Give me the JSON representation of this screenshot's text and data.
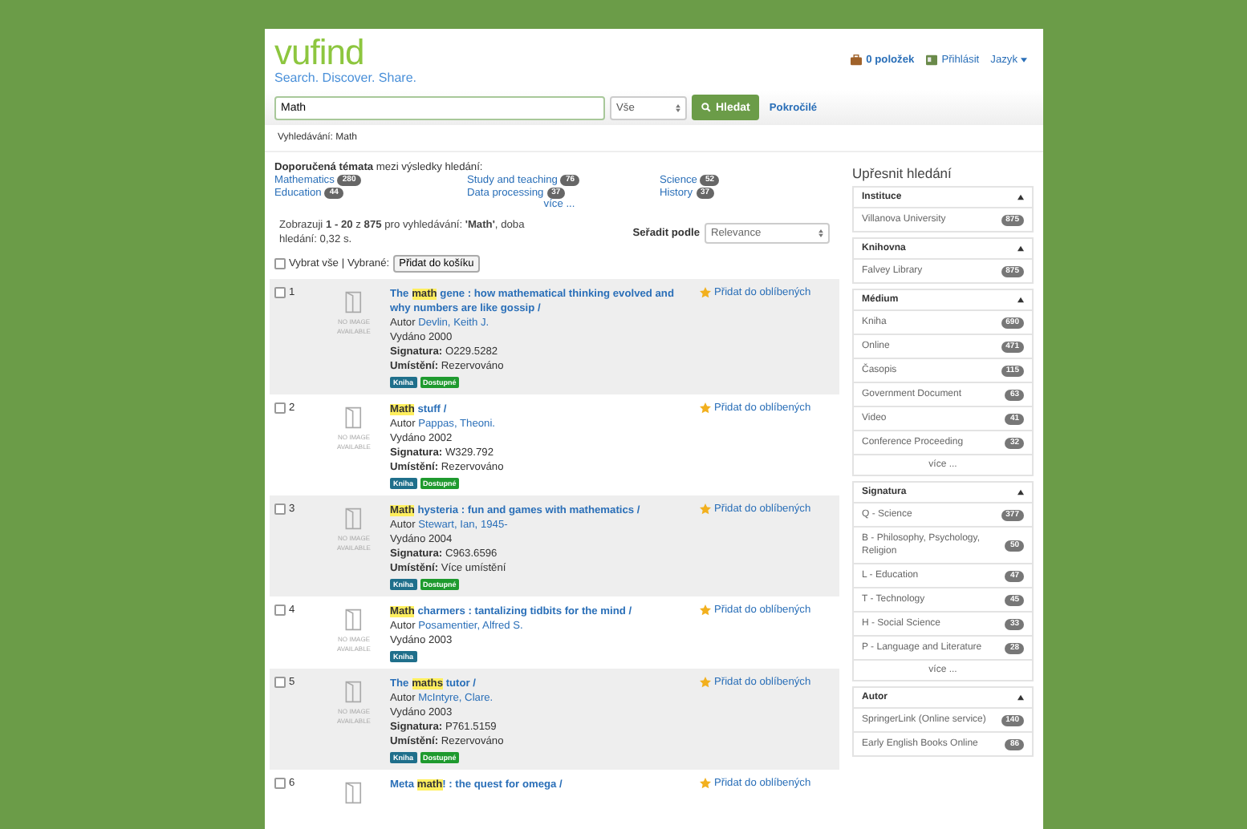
{
  "header": {
    "logo": "vufind",
    "tagline": "Search. Discover. Share.",
    "cart": "0 položek",
    "login": "Přihlásit",
    "language": "Jazyk"
  },
  "search": {
    "value": "Math",
    "scope": "Vše",
    "button": "Hledat",
    "advanced": "Pokročilé"
  },
  "breadcrumb": "Vyhledávání: Math",
  "topics": {
    "heading": "**Doporučená témata** mezi výsledky hledání:",
    "items": [
      {
        "label": "Mathematics",
        "count": "280"
      },
      {
        "label": "Study and teaching",
        "count": "76"
      },
      {
        "label": "Science",
        "count": "52"
      },
      {
        "label": "Education",
        "count": "44"
      },
      {
        "label": "Data processing",
        "count": "37"
      },
      {
        "label": "History",
        "count": "37"
      }
    ],
    "more": "více ..."
  },
  "stats": "Zobrazuji **1 - 20** z **875** pro vyhledávání: **'Math'**, doba hledání: 0,32 s.",
  "sort": {
    "label": "Seřadit podle",
    "value": "Relevance"
  },
  "bulk": {
    "checked": false,
    "select_all": "Vybrat vše",
    "selected_label": "| Vybrané:",
    "button": "Přidat do košíku"
  },
  "results": [
    {
      "number": "1",
      "checked": false,
      "no_image": "NO IMAGE AVAILABLE",
      "title": {
        "before": "The ",
        "highlight": "math",
        "after": " gene : how mathematical thinking evolved and why numbers are like gossip /"
      },
      "author_label": "Autor",
      "author": "Devlin, Keith J.",
      "published": "Vydáno 2000",
      "call_label": "Signatura:",
      "call": "O229.5282",
      "location_label": "Umístění:",
      "location": "Rezervováno",
      "tags": [
        {
          "kind": "format",
          "text": "Kniha"
        },
        {
          "kind": "status",
          "text": "Dostupné"
        }
      ],
      "favorite": "Přidat do oblíbených"
    },
    {
      "number": "2",
      "checked": false,
      "no_image": "NO IMAGE AVAILABLE",
      "title": {
        "highlight": "Math",
        "after": " stuff /"
      },
      "author_label": "Autor",
      "author": "Pappas, Theoni.",
      "published": "Vydáno 2002",
      "call_label": "Signatura:",
      "call": "W329.792",
      "location_label": "Umístění:",
      "location": "Rezervováno",
      "tags": [
        {
          "kind": "format",
          "text": "Kniha"
        },
        {
          "kind": "status",
          "text": "Dostupné"
        }
      ],
      "favorite": "Přidat do oblíbených"
    },
    {
      "number": "3",
      "checked": false,
      "no_image": "NO IMAGE AVAILABLE",
      "title": {
        "highlight": "Math",
        "after": " hysteria : fun and games with mathematics /"
      },
      "author_label": "Autor",
      "author": "Stewart, Ian, 1945-",
      "published": "Vydáno 2004",
      "call_label": "Signatura:",
      "call": "C963.6596",
      "location_label": "Umístění:",
      "location": "Více umístění",
      "tags": [
        {
          "kind": "format",
          "text": "Kniha"
        },
        {
          "kind": "status",
          "text": "Dostupné"
        }
      ],
      "favorite": "Přidat do oblíbených"
    },
    {
      "number": "4",
      "checked": false,
      "no_image": "NO IMAGE AVAILABLE",
      "title": {
        "highlight": "Math",
        "after": " charmers : tantalizing tidbits for the mind /"
      },
      "author_label": "Autor",
      "author": "Posamentier, Alfred S.",
      "published": "Vydáno 2003",
      "tags": [
        {
          "kind": "format",
          "text": "Kniha"
        }
      ],
      "favorite": "Přidat do oblíbených"
    },
    {
      "number": "5",
      "checked": false,
      "no_image": "NO IMAGE AVAILABLE",
      "title": {
        "before": "The ",
        "highlight": "maths",
        "after": " tutor /"
      },
      "author_label": "Autor",
      "author": "McIntyre, Clare.",
      "published": "Vydáno 2003",
      "call_label": "Signatura:",
      "call": "P761.5159",
      "location_label": "Umístění:",
      "location": "Rezervováno",
      "tags": [
        {
          "kind": "format",
          "text": "Kniha"
        },
        {
          "kind": "status",
          "text": "Dostupné"
        }
      ],
      "favorite": "Přidat do oblíbených"
    },
    {
      "number": "6",
      "checked": false,
      "title": {
        "before": "Meta ",
        "highlight": "math",
        "after": "! : the quest for omega /"
      },
      "favorite": "Přidat do oblíbených"
    }
  ],
  "sidebar": {
    "title": "Upřesnit hledání",
    "facets": [
      {
        "title": "Instituce",
        "expanded": true,
        "items": [
          {
            "label": "Villanova University",
            "count": "875"
          }
        ]
      },
      {
        "title": "Knihovna",
        "expanded": true,
        "items": [
          {
            "label": "Falvey Library",
            "count": "875"
          }
        ]
      },
      {
        "title": "Médium",
        "expanded": true,
        "items": [
          {
            "label": "Kniha",
            "count": "690"
          },
          {
            "label": "Online",
            "count": "471"
          },
          {
            "label": "Časopis",
            "count": "115"
          },
          {
            "label": "Government Document",
            "count": "63"
          },
          {
            "label": "Video",
            "count": "41"
          },
          {
            "label": "Conference Proceeding",
            "count": "32"
          }
        ],
        "more": "více ..."
      },
      {
        "title": "Signatura",
        "expanded": true,
        "items": [
          {
            "label": "Q - Science",
            "count": "377"
          },
          {
            "label": "B - Philosophy, Psychology, Religion",
            "count": "50"
          },
          {
            "label": "L - Education",
            "count": "47"
          },
          {
            "label": "T - Technology",
            "count": "45"
          },
          {
            "label": "H - Social Science",
            "count": "33"
          },
          {
            "label": "P - Language and Literature",
            "count": "28"
          }
        ],
        "more": "více ..."
      },
      {
        "title": "Autor",
        "expanded": true,
        "items": [
          {
            "label": "SpringerLink (Online service)",
            "count": "140"
          },
          {
            "label": "Early English Books Online",
            "count": "86"
          }
        ]
      }
    ]
  }
}
